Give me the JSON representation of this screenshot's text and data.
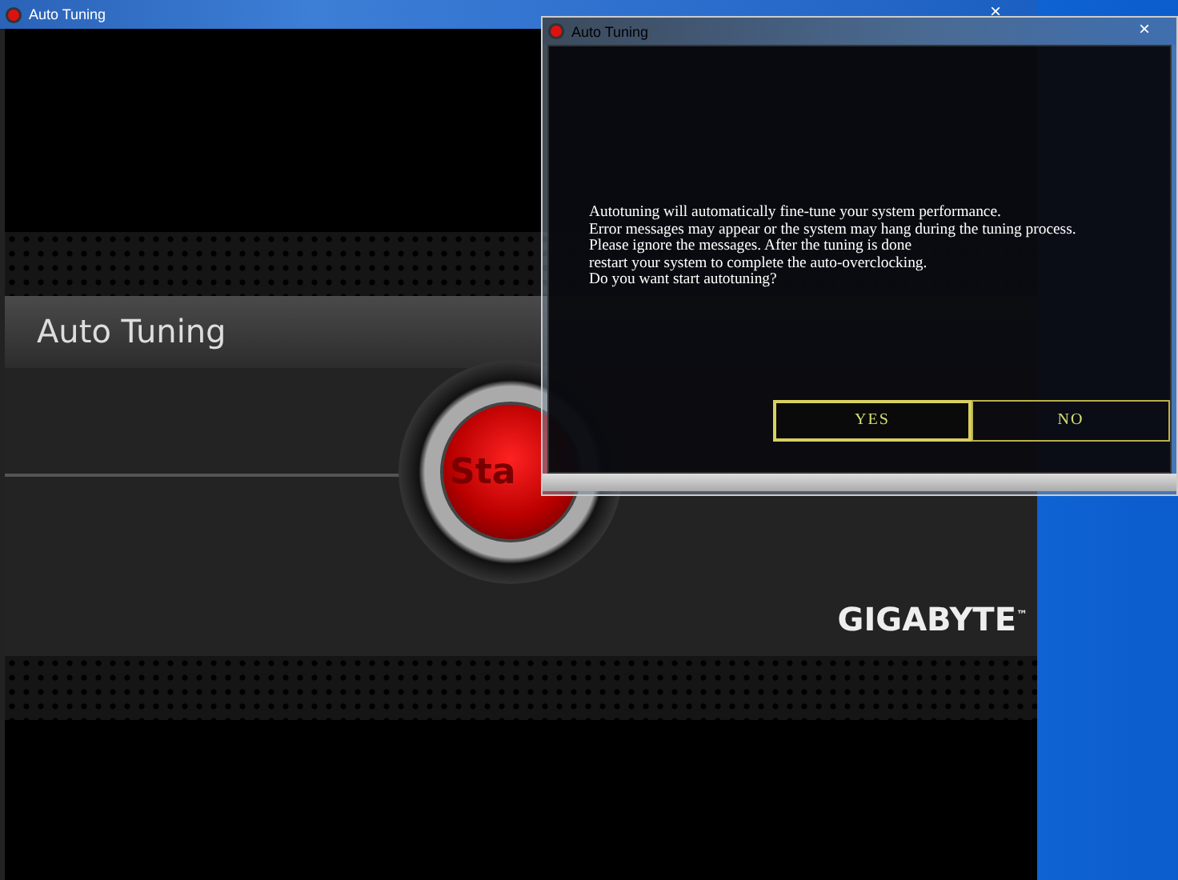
{
  "main_window": {
    "title": "Auto Tuning",
    "close": "×",
    "panel_title": "Auto Tuning",
    "start_button": "Sta",
    "brand": "GIGABYTE",
    "trademark": "™"
  },
  "dialog": {
    "title": "Auto Tuning",
    "close": "×",
    "message": [
      "Autotuning will automatically fine-tune your system performance.",
      "Error messages may appear or the system may hang during the tuning process.",
      "Please ignore the messages. After the tuning is done",
      "restart your system to complete the auto-overclocking.",
      "Do you want start autotuning?"
    ],
    "buttons": [
      {
        "label": "YES",
        "selected": true
      },
      {
        "label": "NO",
        "selected": false
      }
    ]
  }
}
